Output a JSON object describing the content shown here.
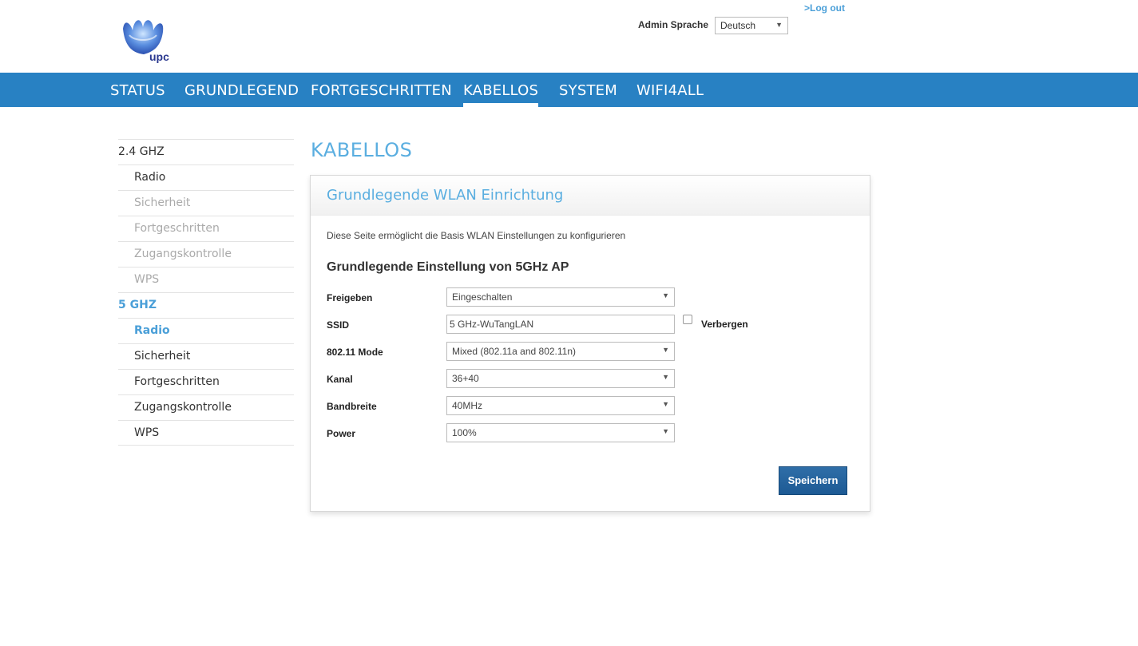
{
  "header": {
    "logo_text": "upc",
    "logout_label": ">Log out",
    "lang_label": "Admin Sprache",
    "lang_value": "Deutsch"
  },
  "nav": {
    "items": [
      {
        "label": "STATUS"
      },
      {
        "label": "GRUNDLEGEND"
      },
      {
        "label": "FORTGESCHRITTEN"
      },
      {
        "label": "KABELLOS",
        "active": true
      },
      {
        "label": "SYSTEM"
      },
      {
        "label": "WIFI4ALL"
      }
    ]
  },
  "sidebar": {
    "items": [
      {
        "label": "2.4 GHZ"
      },
      {
        "label": "Radio"
      },
      {
        "label": "Sicherheit"
      },
      {
        "label": "Fortgeschritten"
      },
      {
        "label": "Zugangskontrolle"
      },
      {
        "label": "WPS"
      },
      {
        "label": "5 GHZ"
      },
      {
        "label": "Radio"
      },
      {
        "label": "Sicherheit"
      },
      {
        "label": "Fortgeschritten"
      },
      {
        "label": "Zugangskontrolle"
      },
      {
        "label": "WPS"
      }
    ]
  },
  "main": {
    "page_title": "KABELLOS",
    "panel_title": "Grundlegende WLAN Einrichtung",
    "description": "Diese Seite ermöglicht die Basis WLAN Einstellungen zu konfigurieren",
    "section_title": "Grundlegende Einstellung von 5GHz AP",
    "fields": {
      "freigeben": {
        "label": "Freigeben",
        "value": "Eingeschalten"
      },
      "ssid": {
        "label": "SSID",
        "value": "5 GHz-WuTangLAN"
      },
      "mode": {
        "label": "802.11 Mode",
        "value": "Mixed (802.11a and 802.11n)"
      },
      "kanal": {
        "label": "Kanal",
        "value": "36+40"
      },
      "bandbreite": {
        "label": "Bandbreite",
        "value": "40MHz"
      },
      "power": {
        "label": "Power",
        "value": "100%"
      }
    },
    "hide_label": "Verbergen",
    "save_label": "Speichern"
  },
  "colors": {
    "nav_bg": "#2881c3",
    "accent": "#5aaee0",
    "button": "#1d5a94"
  }
}
